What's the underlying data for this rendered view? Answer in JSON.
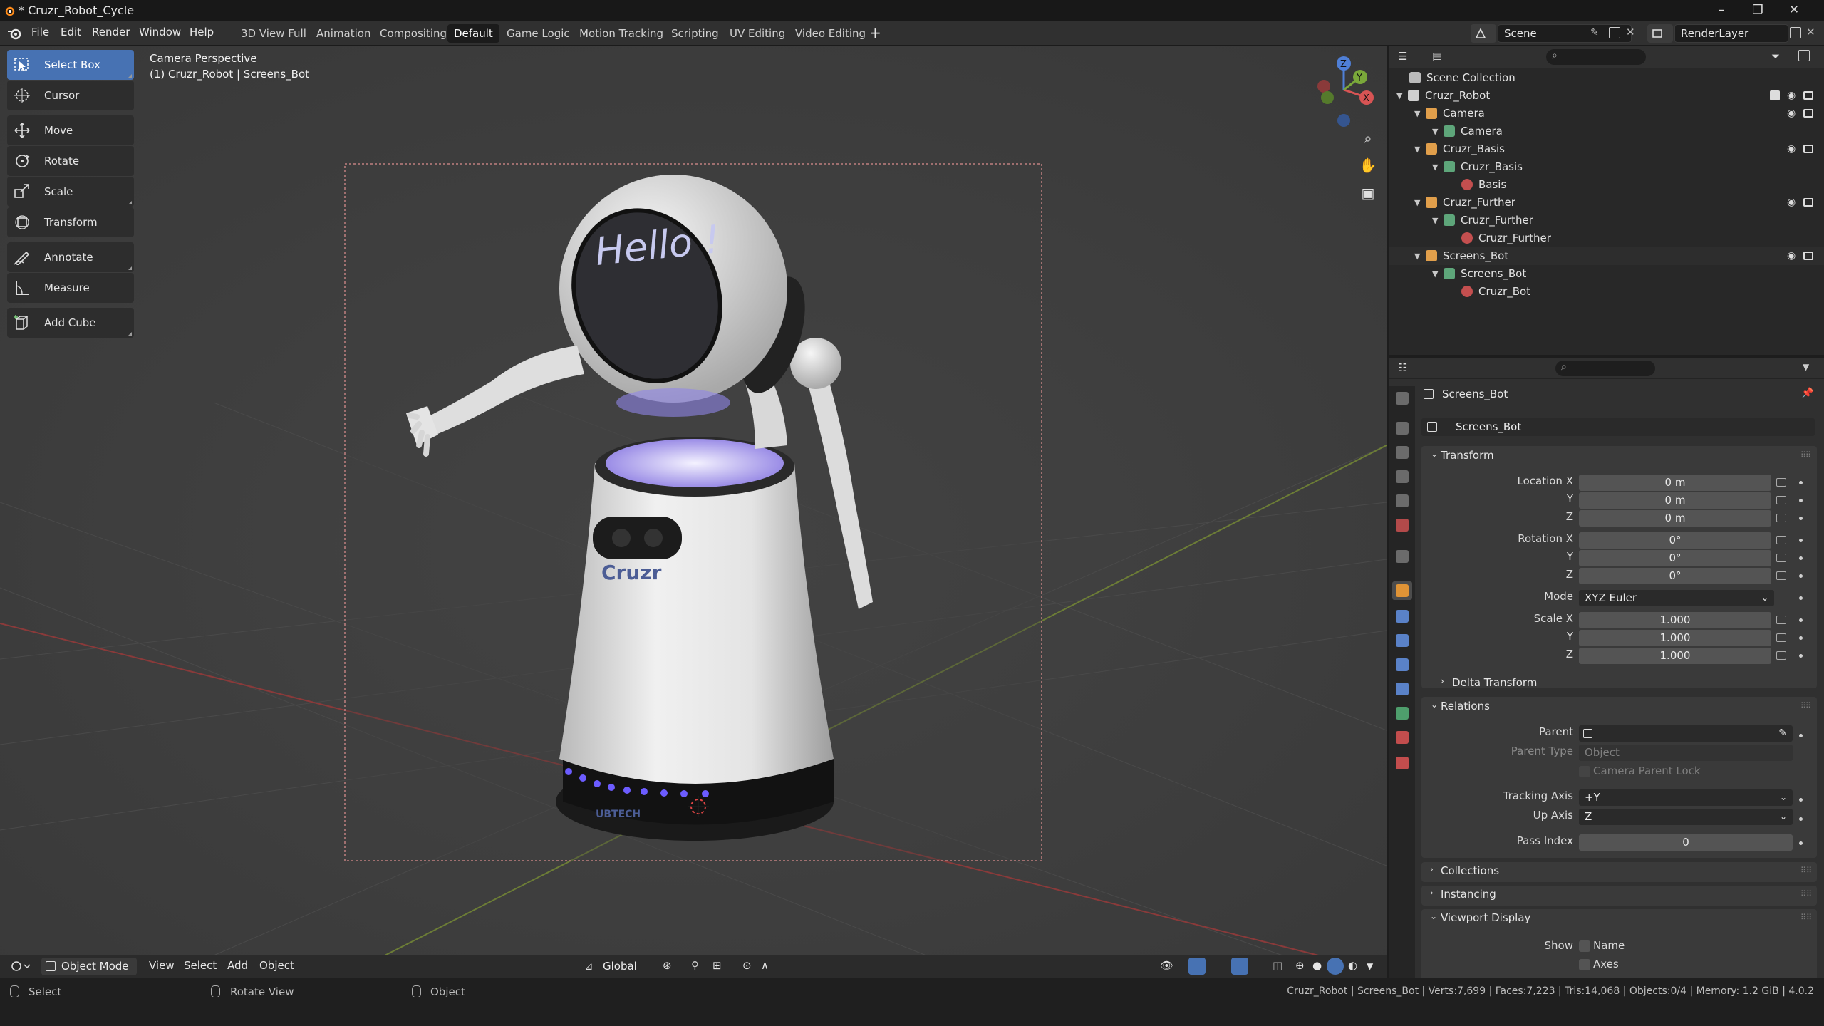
{
  "title_bar": {
    "title": "* Cruzr_Robot_Cycle"
  },
  "menu": [
    "File",
    "Edit",
    "Render",
    "Window",
    "Help"
  ],
  "workspaces": [
    "3D View Full",
    "Animation",
    "Compositing",
    "Default",
    "Game Logic",
    "Motion Tracking",
    "Scripting",
    "UV Editing",
    "Video Editing"
  ],
  "active_workspace": "Default",
  "scene": {
    "name": "Scene",
    "render_layer": "RenderLayer"
  },
  "toolbar": [
    {
      "label": "Select Box",
      "icon": "select-box-icon",
      "active": true
    },
    {
      "label": "Cursor",
      "icon": "cursor-icon"
    },
    {
      "label": "Move",
      "icon": "move-icon"
    },
    {
      "label": "Rotate",
      "icon": "rotate-icon"
    },
    {
      "label": "Scale",
      "icon": "scale-icon"
    },
    {
      "label": "Transform",
      "icon": "transform-icon"
    },
    {
      "label": "Annotate",
      "icon": "annotate-icon"
    },
    {
      "label": "Measure",
      "icon": "measure-icon"
    },
    {
      "label": "Add Cube",
      "icon": "add-cube-icon"
    }
  ],
  "viewport": {
    "perspective": "Camera Perspective",
    "object_info": "(1) Cruzr_Robot | Screens_Bot",
    "screen_text": "Hello !",
    "brand_text": "Cruzr",
    "maker_text": "UBTECH",
    "gizmo": {
      "z": "Z",
      "x": "X",
      "y": "Y"
    }
  },
  "viewport_header": {
    "mode": "Object Mode",
    "menus": [
      "View",
      "Select",
      "Add",
      "Object"
    ],
    "orientation": "Global"
  },
  "status": {
    "select": "Select",
    "rotate": "Rotate View",
    "object": "Object",
    "stats": "Cruzr_Robot | Screens_Bot | Verts:7,699 | Faces:7,223 | Tris:14,068 | Objects:0/4 | Memory: 1.2 GiB | 4.0.2"
  },
  "outliner": {
    "root": "Scene Collection",
    "rows": [
      {
        "label": "Cruzr_Robot",
        "level": 0,
        "icon": "collection-icon",
        "icon_color": "#cfcfcf",
        "vis": true,
        "check": true
      },
      {
        "label": "Camera",
        "level": 1,
        "icon": "camera-object-icon",
        "icon_color": "#e19f4b",
        "vis": true
      },
      {
        "label": "Camera",
        "level": 2,
        "icon": "camera-data-icon",
        "icon_color": "#5ea67a"
      },
      {
        "label": "Cruzr_Basis",
        "level": 1,
        "icon": "mesh-object-icon",
        "icon_color": "#e19f4b",
        "vis": true
      },
      {
        "label": "Cruzr_Basis",
        "level": 2,
        "icon": "mesh-data-icon",
        "icon_color": "#5ea67a"
      },
      {
        "label": "Basis",
        "level": 3,
        "icon": "material-icon",
        "icon_color": "#c44f4f"
      },
      {
        "label": "Cruzr_Further",
        "level": 1,
        "icon": "mesh-object-icon",
        "icon_color": "#e19f4b",
        "vis": true
      },
      {
        "label": "Cruzr_Further",
        "level": 2,
        "icon": "mesh-data-icon",
        "icon_color": "#5ea67a"
      },
      {
        "label": "Cruzr_Further",
        "level": 3,
        "icon": "material-icon",
        "icon_color": "#c44f4f"
      },
      {
        "label": "Screens_Bot",
        "level": 1,
        "icon": "mesh-object-icon",
        "icon_color": "#e19f4b",
        "vis": true,
        "selected": true
      },
      {
        "label": "Screens_Bot",
        "level": 2,
        "icon": "mesh-data-icon",
        "icon_color": "#5ea67a"
      },
      {
        "label": "Cruzr_Bot",
        "level": 3,
        "icon": "material-icon",
        "icon_color": "#c44f4f"
      }
    ]
  },
  "properties": {
    "object_name": "Screens_Bot",
    "datablock": "Screens_Bot",
    "transform": {
      "header": "Transform",
      "location_label": "Location X",
      "rotation_label": "Rotation X",
      "scale_label": "Scale X",
      "axis_y": "Y",
      "axis_z": "Z",
      "location": [
        "0 m",
        "0 m",
        "0 m"
      ],
      "rotation": [
        "0°",
        "0°",
        "0°"
      ],
      "mode_label": "Mode",
      "mode": "XYZ Euler",
      "scale": [
        "1.000",
        "1.000",
        "1.000"
      ]
    },
    "delta_transform": "Delta Transform",
    "relations": {
      "header": "Relations",
      "parent_label": "Parent",
      "parent_type_label": "Parent Type",
      "parent_type": "Object",
      "camera_parent_lock": "Camera Parent Lock",
      "tracking_axis_label": "Tracking Axis",
      "tracking_axis": "+Y",
      "up_axis_label": "Up Axis",
      "up_axis": "Z",
      "pass_index_label": "Pass Index",
      "pass_index": "0"
    },
    "collections": "Collections",
    "instancing": "Instancing",
    "viewport_display": {
      "header": "Viewport Display",
      "show_label": "Show",
      "name": "Name",
      "axes": "Axes"
    }
  },
  "colors": {
    "accent": "#4772b3",
    "panel": "#303030",
    "viewport": "#3c3c3c"
  }
}
